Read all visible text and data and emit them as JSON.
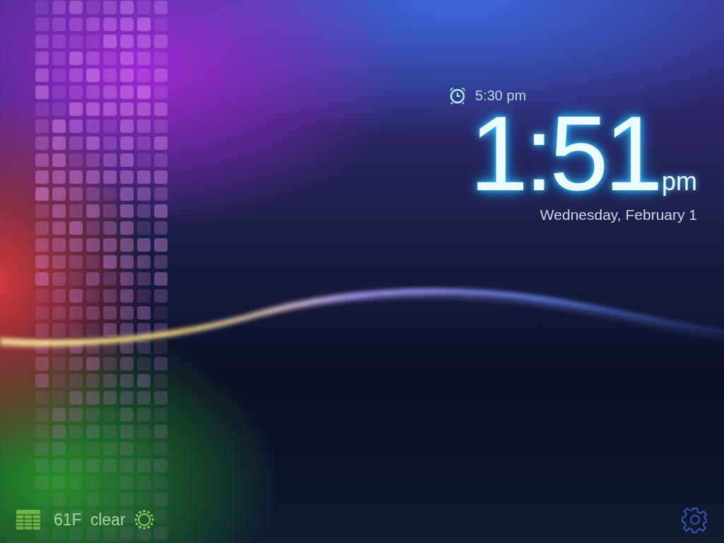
{
  "alarm": {
    "time": "5:30 pm"
  },
  "clock": {
    "time": "1:51",
    "period": "pm",
    "date": "Wednesday, February 1"
  },
  "weather": {
    "temperature": "61F",
    "condition": "clear"
  }
}
